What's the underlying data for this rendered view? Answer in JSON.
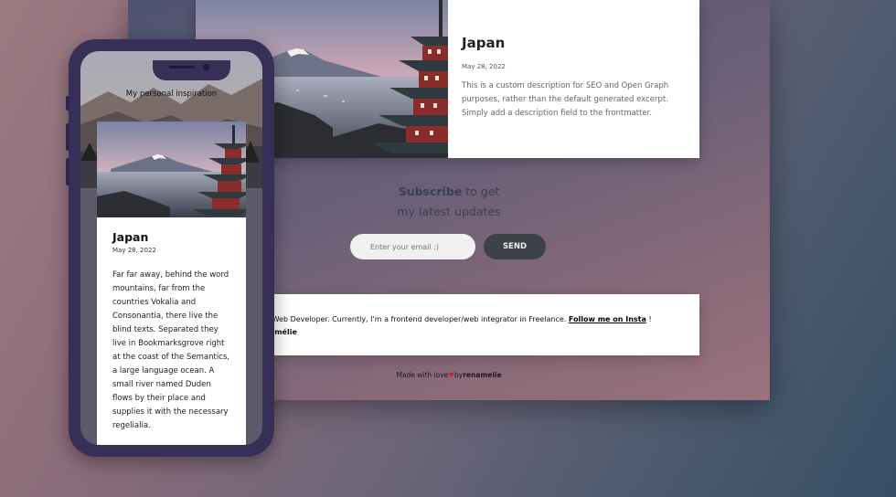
{
  "desktop": {
    "post": {
      "title": "Japan",
      "date": "May 28, 2022",
      "description": "This is a custom description for SEO and Open Graph purposes, rather than the default generated excerpt. Simply add a description field to the frontmatter."
    },
    "subscribe": {
      "bold": "Subscribe",
      "rest": "to get",
      "line2": "my latest updates",
      "email_placeholder": "Enter your email :)",
      "send_label": "SEND"
    },
    "about": {
      "line1_text": "n Web Developer. Currently, I'm a frontend developer/web integrator in Freelance.",
      "follow_link": "Follow me on Insta",
      "line1_end": "!",
      "signature": "Amélie"
    },
    "footer": {
      "prefix": "Made with love",
      "by": "by",
      "author": "renamelie"
    }
  },
  "mobile": {
    "hero_text": "My personal inspiration",
    "post": {
      "title": "Japan",
      "date": "May 28, 2022",
      "body": "Far far away, behind the word mountains, far from the countries Vokalia and Consonantia, there live the blind texts. Separated they live in Bookmarksgrove right at the coast of the Semantics, a large language ocean. A small river named Duden flows by their place and supplies it with the necessary regelialia."
    }
  },
  "colors": {
    "phone_frame": "#372f55",
    "send_button": "#3d4148",
    "heart": "#c0243a"
  },
  "icons": [
    "heart-icon"
  ]
}
